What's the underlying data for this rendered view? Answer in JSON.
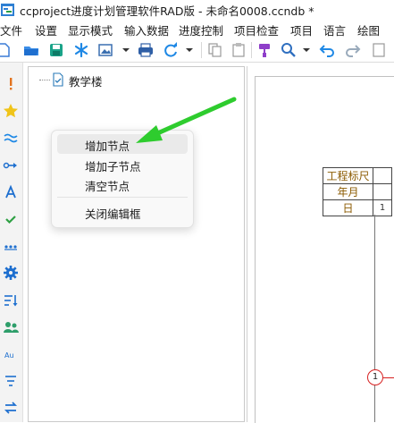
{
  "window": {
    "title": "ccproject进度计划管理软件RAD版 - 未命名0008.ccndb *"
  },
  "menubar": {
    "items": [
      "文件",
      "设置",
      "显示模式",
      "输入数据",
      "进度控制",
      "项目检查",
      "项目",
      "语言",
      "绘图"
    ]
  },
  "toolbar": {
    "icons": [
      "new-file-icon",
      "open-folder-icon",
      "save-icon",
      "asterisk-icon",
      "image-icon",
      "print-icon",
      "refresh-icon",
      "copy-icon",
      "paste-icon",
      "format-painter-icon",
      "search-icon",
      "undo-icon",
      "redo-icon",
      "page-icon"
    ]
  },
  "leftbar": {
    "icons": [
      "exclamation-icon",
      "star-icon",
      "wave-icon",
      "arrow-link-icon",
      "text-a-icon",
      "check-icon",
      "dots-icon",
      "gear-icon",
      "sort-icon",
      "people-icon",
      "au-text-icon",
      "filter-icon",
      "swap-icon"
    ]
  },
  "tree": {
    "root_label": "教学楼"
  },
  "context_menu": {
    "items": [
      {
        "label": "增加节点",
        "highlighted": true
      },
      {
        "label": "增加子节点",
        "highlighted": false
      },
      {
        "label": "清空节点",
        "highlighted": false
      },
      {
        "label": "关闭编辑框",
        "highlighted": false
      }
    ]
  },
  "gantt": {
    "ruler_header": "工程标尺",
    "year_month": "年月",
    "day": "日",
    "day_value": "1",
    "node_number": "1"
  },
  "colors": {
    "accent_green": "#2ecc2e",
    "ruler_text": "#8b5a00",
    "node_circle": "#d62020"
  }
}
